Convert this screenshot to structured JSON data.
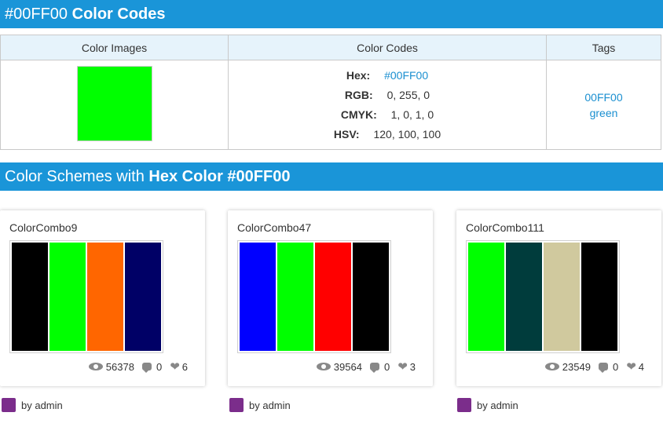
{
  "banner1": {
    "prefix": "#00FF00",
    "bold": "Color Codes"
  },
  "table": {
    "headers": [
      "Color Images",
      "Color Codes",
      "Tags"
    ],
    "swatch": "#00ff00",
    "codes": [
      {
        "label": "Hex:",
        "value": "#00FF00",
        "link": true
      },
      {
        "label": "RGB:",
        "value": "0, 255, 0",
        "link": false
      },
      {
        "label": "CMYK:",
        "value": "1, 0, 1, 0",
        "link": false
      },
      {
        "label": "HSV:",
        "value": "120, 100, 100",
        "link": false
      }
    ],
    "tags": [
      "00FF00",
      "green"
    ]
  },
  "banner2": {
    "prefix": "Color Schemes with ",
    "bold": "Hex Color #00FF00"
  },
  "cards": [
    {
      "name": "ColorCombo9",
      "colors": [
        "#000000",
        "#00ff00",
        "#ff6600",
        "#000066"
      ],
      "views": "56378",
      "comments": "0",
      "likes": "6",
      "author": "by admin"
    },
    {
      "name": "ColorCombo47",
      "colors": [
        "#0000ff",
        "#00ff00",
        "#ff0000",
        "#000000"
      ],
      "views": "39564",
      "comments": "0",
      "likes": "3",
      "author": "by admin"
    },
    {
      "name": "ColorCombo111",
      "colors": [
        "#00ff00",
        "#003c3c",
        "#d0c99e",
        "#000000"
      ],
      "views": "23549",
      "comments": "0",
      "likes": "4",
      "author": "by admin"
    }
  ]
}
